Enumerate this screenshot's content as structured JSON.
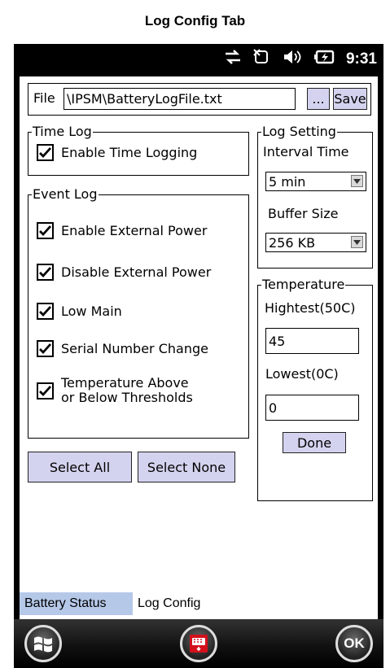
{
  "caption": "Log Config Tab",
  "status_bar": {
    "time": "9:31",
    "icons": [
      "sync-icon",
      "signal-off-icon",
      "volume-icon",
      "battery-charging-icon"
    ]
  },
  "file": {
    "label": "File",
    "path": "\\IPSM\\BatteryLogFile.txt",
    "browse_label": "...",
    "save_label": "Save"
  },
  "time_log": {
    "title": "Time Log",
    "enable_label": "Enable Time Logging",
    "enabled": true
  },
  "event_log": {
    "title": "Event Log",
    "items": [
      {
        "label": "Enable External Power",
        "checked": true
      },
      {
        "label": "Disable External Power",
        "checked": true
      },
      {
        "label": "Low Main",
        "checked": true
      },
      {
        "label": "Serial Number Change",
        "checked": true
      },
      {
        "label_line1": "Temperature Above",
        "label_line2": "or Below Thresholds",
        "checked": true
      }
    ]
  },
  "log_setting": {
    "title": "Log Setting",
    "interval_label": "Interval Time",
    "interval_value": "5 min",
    "buffer_label": "Buffer Size",
    "buffer_value": "256 KB"
  },
  "temperature": {
    "title": "Temperature",
    "highest_label": "Hightest(50C)",
    "highest_value": "45",
    "lowest_label": "Lowest(0C)",
    "lowest_value": "0",
    "done_label": "Done"
  },
  "buttons": {
    "select_all": "Select All",
    "select_none": "Select None"
  },
  "tabs": [
    {
      "label": "Battery Status",
      "active": false
    },
    {
      "label": "Log Config",
      "active": true
    }
  ],
  "softkeys": {
    "start_icon": "windows-start-icon",
    "keyboard_icon": "keyboard-icon",
    "ok_label": "OK"
  },
  "colors": {
    "button_fill": "#d4d3ef",
    "inactive_tab": "#b5c8e8",
    "keyboard_red": "#d4101c"
  }
}
